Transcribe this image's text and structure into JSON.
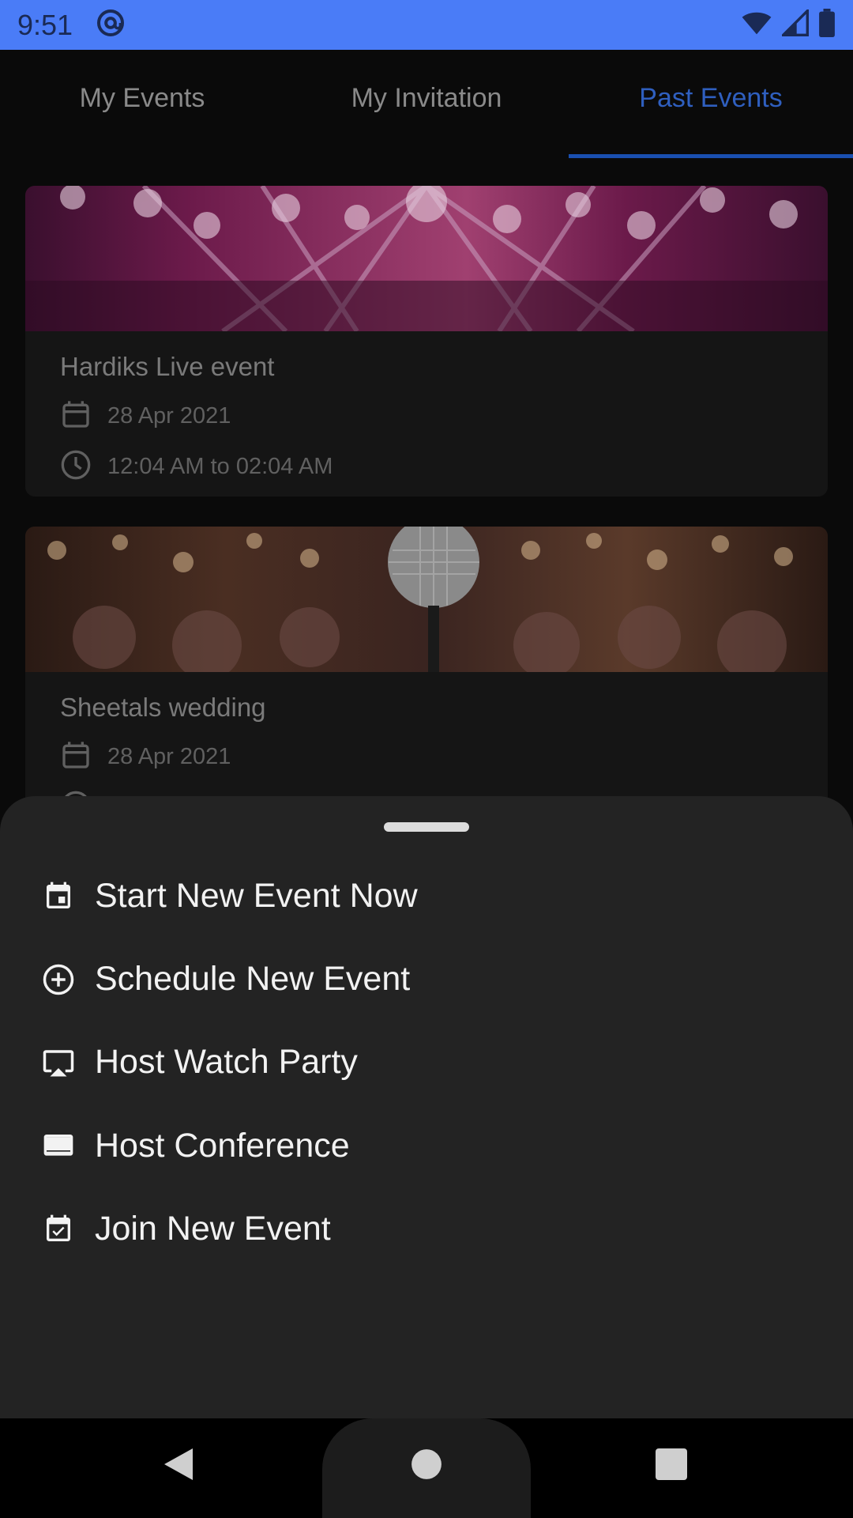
{
  "status_bar": {
    "time": "9:51",
    "icons": [
      "notification-at-icon",
      "wifi-icon",
      "signal-icon",
      "battery-icon"
    ]
  },
  "tabs": [
    {
      "label": "My Events",
      "active": false
    },
    {
      "label": "My Invitation",
      "active": false
    },
    {
      "label": "Past Events",
      "active": true
    }
  ],
  "events": [
    {
      "title": "Hardiks Live event",
      "date": "28 Apr 2021",
      "time": "12:04 AM to 02:04 AM"
    },
    {
      "title": "Sheetals wedding",
      "date": "28 Apr 2021",
      "time": ""
    }
  ],
  "sheet": {
    "items": [
      {
        "label": "Start New Event Now",
        "icon": "event-icon"
      },
      {
        "label": "Schedule New Event",
        "icon": "add-circle-icon"
      },
      {
        "label": "Host Watch Party",
        "icon": "airplay-icon"
      },
      {
        "label": "Host Conference",
        "icon": "video-label-icon"
      },
      {
        "label": "Join New Event",
        "icon": "event-available-icon"
      }
    ]
  },
  "nav": {
    "buttons": [
      "back-icon",
      "home-icon",
      "recents-icon"
    ]
  },
  "colors": {
    "status_bar": "#4a7cf7",
    "accent": "#1a4fb0",
    "sheet_bg": "#232323"
  }
}
